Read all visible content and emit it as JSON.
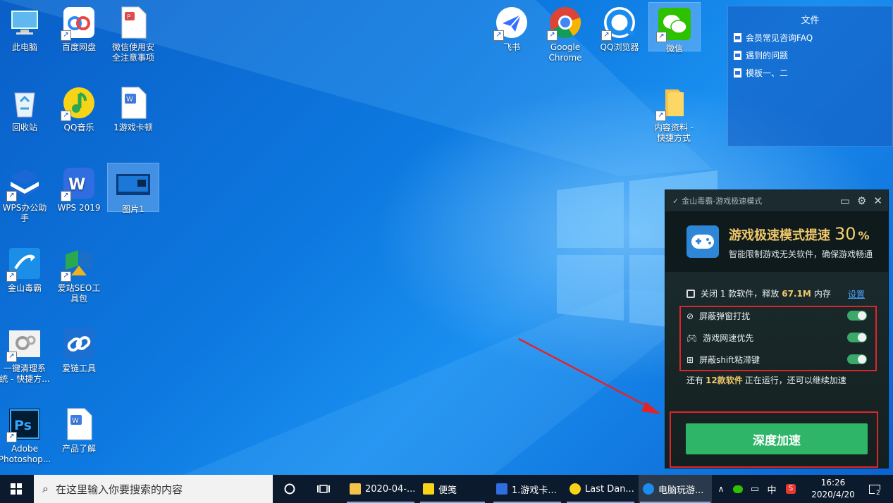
{
  "desktop_icons": {
    "this_pc": "此电脑",
    "baidu_netdisk": "百度网盘",
    "wechat_safety_1": "微信使用安",
    "wechat_safety_2": "全注意事项",
    "recycle_bin": "回收站",
    "qq_music": "QQ音乐",
    "game_lag": "1游戏卡顿",
    "wps_assistant_1": "WPS办公助",
    "wps_assistant_2": "手",
    "wps_2019": "WPS 2019",
    "picture1": "图片1",
    "duba": "金山毒霸",
    "seo_1": "爱站SEO工",
    "seo_2": "具包",
    "cleaner_1": "一键清理系",
    "cleaner_2": "统 - 快捷方...",
    "aisilian": "爱链工具",
    "photoshop_1": "Adobe",
    "photoshop_2": "Photoshop...",
    "product": "产品了解",
    "feishu": "飞书",
    "chrome_1": "Google",
    "chrome_2": "Chrome",
    "qq_browser": "QQ浏览器",
    "wechat": "微信",
    "content_1": "内容资料 -",
    "content_2": "快捷方式"
  },
  "file_widget": {
    "title": "文件",
    "items": [
      "会员常见咨询FAQ",
      "遇到的问题",
      "模板一、二"
    ]
  },
  "game_panel": {
    "header_title": "金山毒霸-游戏极速模式",
    "headline": "游戏极速模式提速",
    "percent": "30",
    "percent_sign": "%",
    "subline": "智能限制游戏无关软件，确保游戏畅通",
    "status_prefix": "关闭 1 款软件，释放",
    "status_mem": "67.1M",
    "status_suffix": "内存",
    "settings_link": "设置",
    "options": [
      "屏蔽弹窗打扰",
      "游戏网速优先",
      "屏蔽shift粘滞键"
    ],
    "remaining_prefix": "还有",
    "remaining_count": "12款软件",
    "remaining_suffix": "正在运行，还可以继续加速",
    "accelerate_button": "深度加速"
  },
  "taskbar": {
    "search_placeholder": "在这里输入你要搜索的内容",
    "apps": [
      "2020-04-...",
      "便笺",
      "1.游戏卡...",
      "Last Dan...",
      "电脑玩游..."
    ],
    "ime": "中",
    "time": "16:26",
    "date": "2020/4/20",
    "notification_count": "2"
  },
  "colors": {
    "accent_green": "#2fb567",
    "highlight_gold": "#f0c86a",
    "annotation_red": "#e0252a"
  }
}
